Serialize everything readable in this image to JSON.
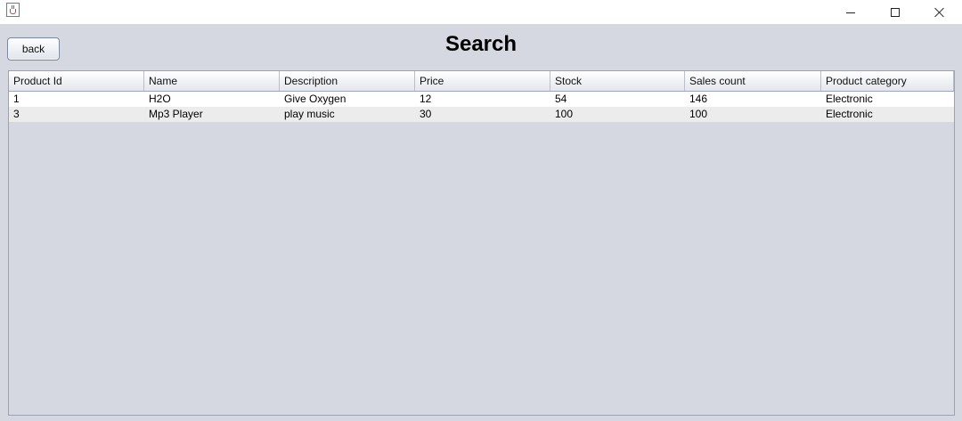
{
  "window": {
    "minimize_icon": "minimize-icon",
    "maximize_icon": "maximize-icon",
    "close_icon": "close-icon"
  },
  "toolbar": {
    "back_label": "back"
  },
  "page": {
    "title": "Search"
  },
  "table": {
    "columns": [
      "Product Id",
      "Name",
      "Description",
      "Price",
      "Stock",
      "Sales count",
      "Product category"
    ],
    "rows": [
      [
        "1",
        "H2O",
        "Give Oxygen",
        "12",
        "54",
        "146",
        "Electronic"
      ],
      [
        "3",
        "Mp3 Player",
        "play music",
        "30",
        "100",
        "100",
        "Electronic"
      ]
    ]
  },
  "colors": {
    "background": "#d5d8e0",
    "row_odd": "#ffffff",
    "row_even": "#ececec"
  }
}
